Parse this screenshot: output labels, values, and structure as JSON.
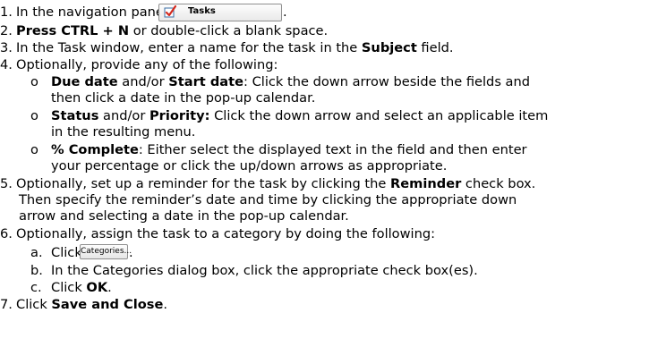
{
  "steps": {
    "s1": {
      "num": "1.",
      "text": "In the navigation pane, click",
      "button": "Tasks",
      "end": "."
    },
    "s2": {
      "num": "2.",
      "bold": "Press CTRL + N",
      "rest": " or double-click a blank space."
    },
    "s3": {
      "num": "3.",
      "pre": "In the Task window, enter a name for the task in the ",
      "bold": "Subject",
      "post": " field."
    },
    "s4": {
      "num": "4.",
      "text": "Optionally, provide any of the following:",
      "bullet": "o",
      "b1": {
        "bold1": "Due date",
        "mid": " and/or ",
        "bold2": "Start date",
        "rest": ": Click the down arrow beside the fields and",
        "line2": "then click a date in the pop-up calendar."
      },
      "b2": {
        "bold1": "Status",
        "mid": " and/or ",
        "bold2": "Priority:",
        "rest": " Click the down arrow and select an applicable item",
        "line2": "in the resulting menu."
      },
      "b3": {
        "bold": "% Complete",
        "rest": ": Either select the displayed text in the field and then enter",
        "line2": "your percentage or click the up/down arrows as appropriate."
      }
    },
    "s5": {
      "num": "5.",
      "pre": "Optionally, set up a reminder for the task by clicking the ",
      "bold": "Reminder",
      "post": " check box.",
      "line2": "Then specify the reminder’s date and time by clicking the appropriate down",
      "line3": "arrow and selecting a date in the pop-up calendar."
    },
    "s6": {
      "num": "6.",
      "text": "Optionally, assign the task to a category by doing the following:",
      "a": {
        "letter": "a.",
        "text": "Click",
        "button": "Categories...",
        "end": "."
      },
      "b": {
        "letter": "b.",
        "text": "In the Categories dialog box, click the appropriate check box(es)."
      },
      "c": {
        "letter": "c.",
        "pre": "Click ",
        "bold": "OK",
        "post": "."
      }
    },
    "s7": {
      "num": "7.",
      "pre": "Click ",
      "bold": "Save and Close",
      "post": "."
    }
  },
  "colors": {
    "check_red": "#d42a1e",
    "check_frame": "#3a6ea5"
  },
  "icons": {
    "tasks": "tasks-checkmark-icon"
  }
}
